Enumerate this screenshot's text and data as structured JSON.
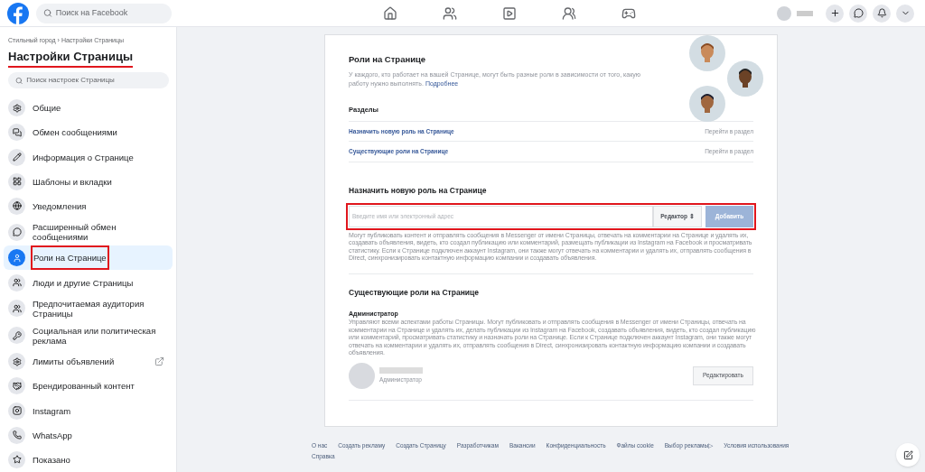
{
  "topbar": {
    "search": {
      "placeholder": "Поиск на Facebook"
    }
  },
  "sidebar": {
    "breadcrumb": "Стильный город › Настройки Страницы",
    "title": "Настройки Страницы",
    "search": {
      "placeholder": "Поиск настроек Страницы"
    },
    "items": [
      {
        "label": "Общие",
        "selected": false,
        "external": false
      },
      {
        "label": "Обмен сообщениями",
        "selected": false,
        "external": false
      },
      {
        "label": "Информация о Странице",
        "selected": false,
        "external": false
      },
      {
        "label": "Шаблоны и вкладки",
        "selected": false,
        "external": false
      },
      {
        "label": "Уведомления",
        "selected": false,
        "external": false
      },
      {
        "label": "Расширенный обмен сообщениями",
        "selected": false,
        "external": false
      },
      {
        "label": "Роли на Странице",
        "selected": true,
        "external": false
      },
      {
        "label": "Люди и другие Страницы",
        "selected": false,
        "external": false
      },
      {
        "label": "Предпочитаемая аудитория Страницы",
        "selected": false,
        "external": false
      },
      {
        "label": "Социальная или политическая реклама",
        "selected": false,
        "external": false
      },
      {
        "label": "Лимиты объявлений",
        "selected": false,
        "external": true
      },
      {
        "label": "Брендированный контент",
        "selected": false,
        "external": false
      },
      {
        "label": "Instagram",
        "selected": false,
        "external": false
      },
      {
        "label": "WhatsApp",
        "selected": false,
        "external": false
      },
      {
        "label": "Показано",
        "selected": false,
        "external": false
      }
    ]
  },
  "intro": {
    "title": "Роли на Странице",
    "text": "У каждого, кто работает на вашей Странице, могут быть разные роли в зависимости от того, какую работу нужно выполнять.",
    "link": "Подробнее",
    "sections_heading": "Разделы",
    "sections": [
      {
        "label": "Назначить новую роль на Странице",
        "action": "Перейти в раздел"
      },
      {
        "label": "Существующие роли на Странице",
        "action": "Перейти в раздел"
      }
    ]
  },
  "assign": {
    "title": "Назначить новую роль на Странице",
    "input": {
      "placeholder": "Введите имя или электронный адрес"
    },
    "role_select": "Редактор ⇕",
    "add_button": {
      "label": "Добавить",
      "disabled": true
    },
    "description": "Могут публиковать контент и отправлять сообщения в Messenger от имени Страницы, отвечать на комментарии на Странице и удалять их, создавать объявления, видеть, кто создал публикацию или комментарий, размещать публикации из Instagram на Facebook и просматривать статистику. Если к Странице подключен аккаунт Instagram, они также могут отвечать на комментарии и удалять их, отправлять сообщения в Direct, синхронизировать контактную информацию компании и создавать объявления."
  },
  "existing": {
    "title": "Существующие роли на Странице",
    "role_title": "Администратор",
    "role_description": "Управляют всеми аспектами работы Страницы. Могут публиковать и отправлять сообщения в Messenger от имени Страницы, отвечать на комментарии на Странице и удалять их, делать публикации из Instagram на Facebook, создавать объявления, видеть, кто создал публикацию или комментарий, просматривать статистику и назначать роли на Странице. Если к Странице подключен аккаунт Instagram, они также могут отвечать на комментарии и удалять их, отправлять сообщения в Direct, синхронизировать контактную информацию компании и создавать объявления.",
    "member_role": "Администратор",
    "edit_button": "Редактировать"
  },
  "footer": {
    "links": [
      "О нас",
      "Создать рекламу",
      "Создать Страницу",
      "Разработчикам",
      "Вакансии",
      "Конфиденциальность",
      "Файлы cookie",
      "Выбор рекламы▷",
      "Условия использования",
      "Справка"
    ]
  }
}
